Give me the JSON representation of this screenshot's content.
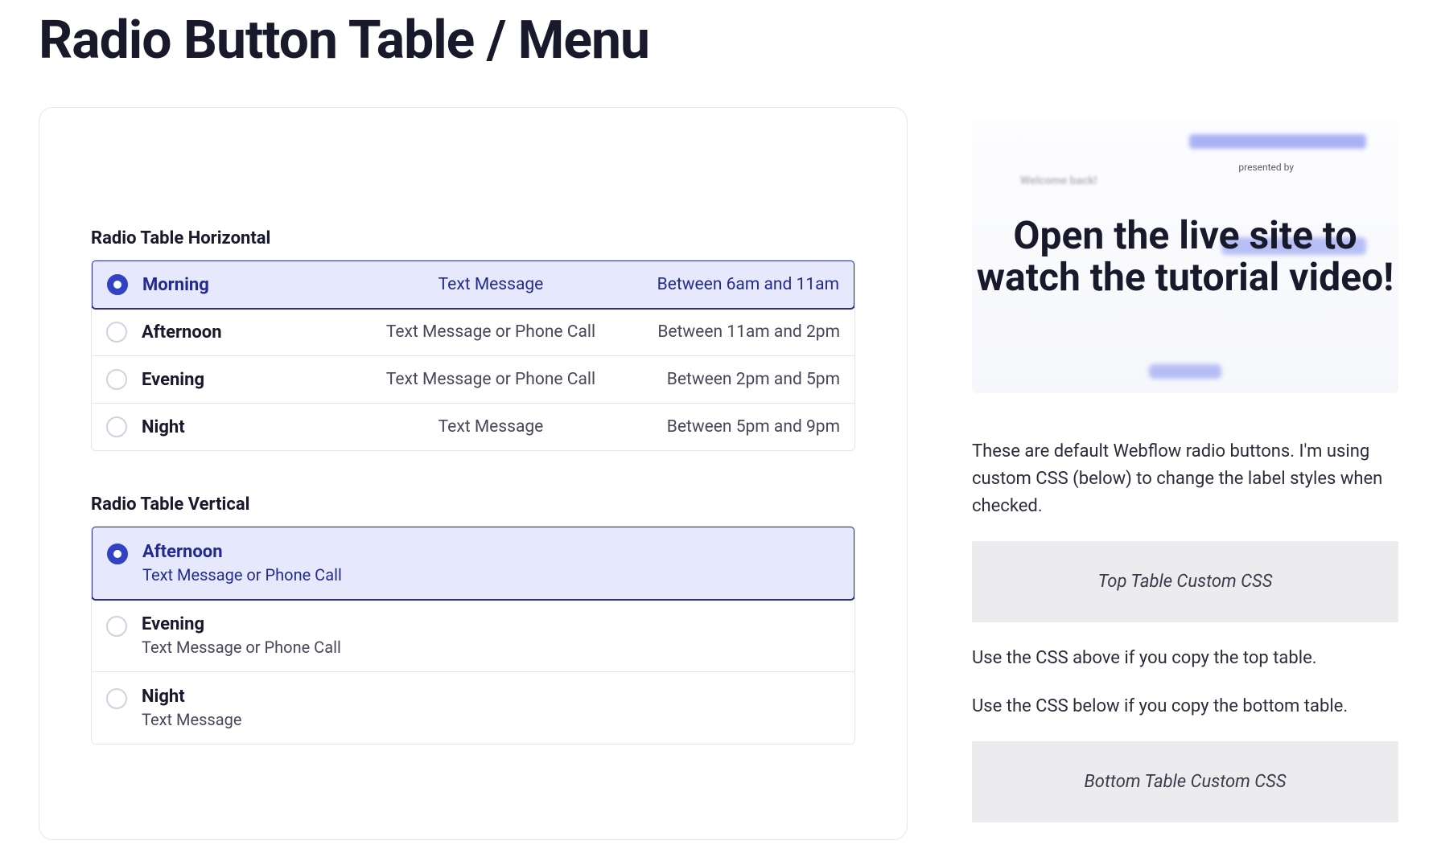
{
  "title": "Radio Button Table / Menu",
  "horizontal": {
    "heading": "Radio Table Horizontal",
    "selectedIndex": 0,
    "rows": [
      {
        "label": "Morning",
        "method": "Text Message",
        "time": "Between 6am and 11am"
      },
      {
        "label": "Afternoon",
        "method": "Text Message or Phone Call",
        "time": "Between 11am and 2pm"
      },
      {
        "label": "Evening",
        "method": "Text Message or Phone Call",
        "time": "Between 2pm and 5pm"
      },
      {
        "label": "Night",
        "method": "Text Message",
        "time": "Between 5pm and 9pm"
      }
    ]
  },
  "vertical": {
    "heading": "Radio Table Vertical",
    "selectedIndex": 0,
    "rows": [
      {
        "label": "Afternoon",
        "sub": "Text Message or Phone Call"
      },
      {
        "label": "Evening",
        "sub": "Text Message or Phone Call"
      },
      {
        "label": "Night",
        "sub": "Text Message"
      }
    ]
  },
  "sidebar": {
    "thumb": {
      "presented": "presented by",
      "welcome": "Welcome back!",
      "text": "Open the live site to watch the tutorial video!"
    },
    "intro": "These are default Webflow radio buttons. I'm using custom CSS (below) to change the label styles when checked.",
    "top_css_label": "Top Table Custom CSS",
    "note_top": "Use the CSS above if you copy the top table.",
    "note_bottom": "Use the CSS below if you copy the bottom table.",
    "bottom_css_label": "Bottom Table Custom CSS"
  }
}
